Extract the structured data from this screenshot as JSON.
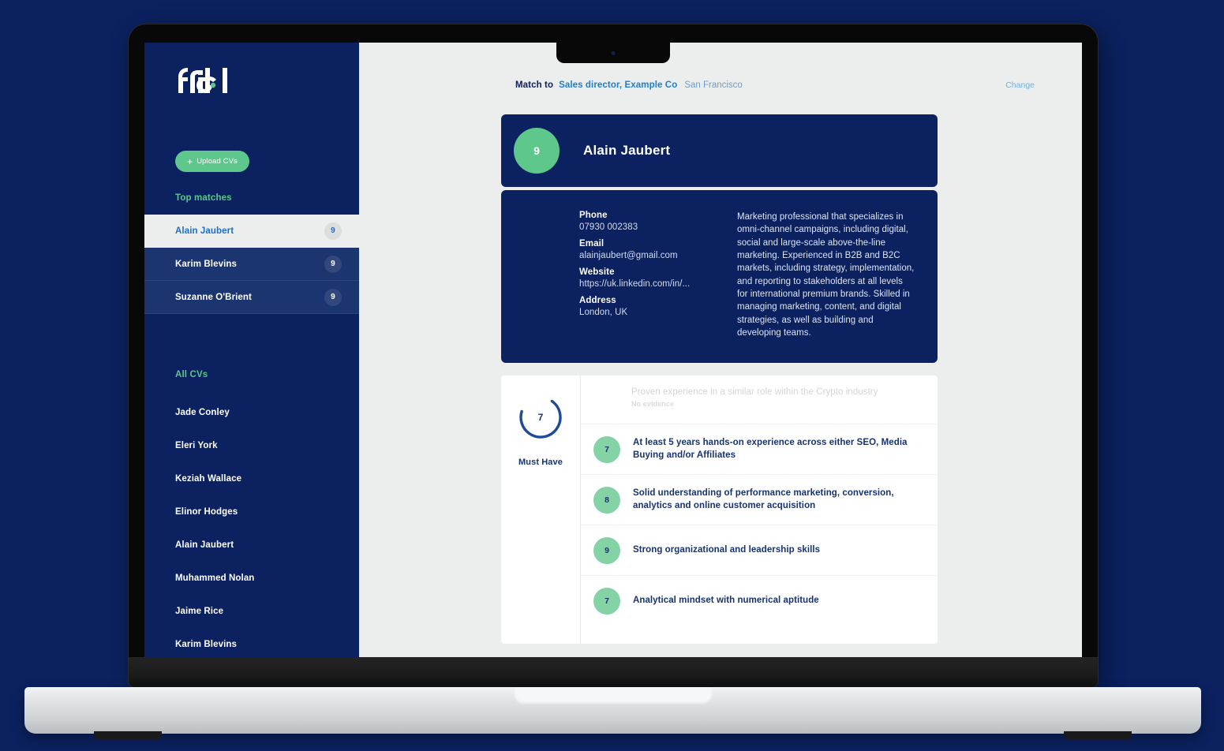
{
  "brand": {
    "logo_text": "fribl",
    "accent_green": "#57c98c",
    "navy": "#0b2160"
  },
  "sidebar": {
    "upload_button": {
      "label": "Upload CVs",
      "plus_icon": "plus-icon"
    },
    "top_matches_title": "Top matches",
    "top_matches": [
      {
        "name": "Alain Jaubert",
        "score": "9",
        "selected": true
      },
      {
        "name": "Karim Blevins",
        "score": "9",
        "selected": false
      },
      {
        "name": "Suzanne O'Brient",
        "score": "9",
        "selected": false
      }
    ],
    "all_cvs_title": "All CVs",
    "all_cvs": [
      {
        "name": "Jade Conley"
      },
      {
        "name": "Eleri York"
      },
      {
        "name": "Keziah Wallace"
      },
      {
        "name": "Elinor Hodges"
      },
      {
        "name": "Alain Jaubert"
      },
      {
        "name": "Muhammed Nolan"
      },
      {
        "name": "Jaime Rice"
      },
      {
        "name": "Karim Blevins"
      }
    ]
  },
  "header": {
    "match_to_label": "Match to",
    "job_title": "Sales director, Example Co",
    "location": "San Francisco",
    "change_label": "Change"
  },
  "candidate": {
    "name": "Alain Jaubert",
    "score": "9",
    "contact": [
      {
        "label": "Phone",
        "value": "07930 002383"
      },
      {
        "label": "Email",
        "value": "alainjaubert@gmail.com"
      },
      {
        "label": "Website",
        "value": "https://uk.linkedin.com/in/..."
      },
      {
        "label": "Address",
        "value": "London, UK"
      }
    ],
    "summary": "Marketing professional that specializes in omni-channel campaigns, including digital, social and large-scale above-the-line marketing. Experienced in B2B and B2C markets, including strategy, implementation, and reporting to stakeholders at all levels for international premium brands. Skilled in managing marketing, content, and digital strategies, as well as building and developing teams."
  },
  "must_have": {
    "gauge_value": "7",
    "gauge_max": 10,
    "gauge_label": "Must Have",
    "criteria": [
      {
        "score": null,
        "text": "Proven experience in a similar role within the Crypto industry",
        "evidence_note": "No evidence",
        "state": "no-evidence"
      },
      {
        "score": "7",
        "text": "At least 5 years hands-on experience across either SEO, Media Buying and/or Affiliates",
        "state": "scored"
      },
      {
        "score": "8",
        "text": "Solid understanding of performance marketing, conversion, analytics and online customer acquisition",
        "state": "scored"
      },
      {
        "score": "9",
        "text": "Strong organizational and leadership skills",
        "state": "scored"
      },
      {
        "score": "7",
        "text": "Analytical mindset with numerical aptitude",
        "state": "scored"
      }
    ]
  }
}
